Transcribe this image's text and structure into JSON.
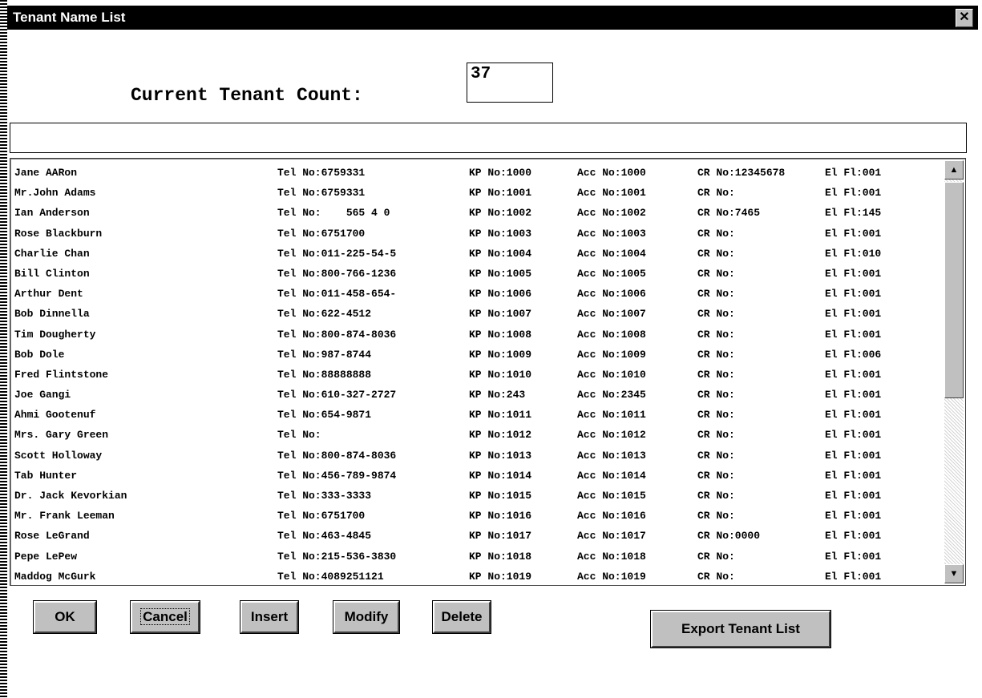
{
  "window": {
    "title": "Tenant Name List",
    "close_glyph": "✕"
  },
  "count": {
    "label": "Current Tenant Count:",
    "value": "37"
  },
  "search": {
    "value": ""
  },
  "tenants": [
    {
      "name": "Jane AARon",
      "tel": "Tel No:6759331",
      "kp": "KP No:1000",
      "acc": "Acc No:1000",
      "cr": "CR No:12345678",
      "el": "El Fl:001"
    },
    {
      "name": "Mr.John Adams",
      "tel": "Tel No:6759331",
      "kp": "KP No:1001",
      "acc": "Acc No:1001",
      "cr": "CR No:",
      "el": "El Fl:001"
    },
    {
      "name": "Ian Anderson",
      "tel": "Tel No:    565 4 0",
      "kp": "KP No:1002",
      "acc": "Acc No:1002",
      "cr": "CR No:7465",
      "el": "El Fl:145"
    },
    {
      "name": "Rose Blackburn",
      "tel": "Tel No:6751700",
      "kp": "KP No:1003",
      "acc": "Acc No:1003",
      "cr": "CR No:",
      "el": "El Fl:001"
    },
    {
      "name": "Charlie Chan",
      "tel": "Tel No:011-225-54-5",
      "kp": "KP No:1004",
      "acc": "Acc No:1004",
      "cr": "CR No:",
      "el": "El Fl:010"
    },
    {
      "name": "Bill Clinton",
      "tel": "Tel No:800-766-1236",
      "kp": "KP No:1005",
      "acc": "Acc No:1005",
      "cr": "CR No:",
      "el": "El Fl:001"
    },
    {
      "name": "Arthur Dent",
      "tel": "Tel No:011-458-654-",
      "kp": "KP No:1006",
      "acc": "Acc No:1006",
      "cr": "CR No:",
      "el": "El Fl:001"
    },
    {
      "name": "Bob Dinnella",
      "tel": "Tel No:622-4512",
      "kp": "KP No:1007",
      "acc": "Acc No:1007",
      "cr": "CR No:",
      "el": "El Fl:001"
    },
    {
      "name": "Tim Dougherty",
      "tel": "Tel No:800-874-8036",
      "kp": "KP No:1008",
      "acc": "Acc No:1008",
      "cr": "CR No:",
      "el": "El Fl:001"
    },
    {
      "name": "Bob Dole",
      "tel": "Tel No:987-8744",
      "kp": "KP No:1009",
      "acc": "Acc No:1009",
      "cr": "CR No:",
      "el": "El Fl:006"
    },
    {
      "name": "Fred Flintstone",
      "tel": "Tel No:88888888",
      "kp": "KP No:1010",
      "acc": "Acc No:1010",
      "cr": "CR No:",
      "el": "El Fl:001"
    },
    {
      "name": "Joe Gangi",
      "tel": "Tel No:610-327-2727",
      "kp": "KP No:243",
      "acc": "Acc No:2345",
      "cr": "CR No:",
      "el": "El Fl:001"
    },
    {
      "name": "Ahmi Gootenuf",
      "tel": "Tel No:654-9871",
      "kp": "KP No:1011",
      "acc": "Acc No:1011",
      "cr": "CR No:",
      "el": "El Fl:001"
    },
    {
      "name": "Mrs. Gary Green",
      "tel": "Tel No:",
      "kp": "KP No:1012",
      "acc": "Acc No:1012",
      "cr": "CR No:",
      "el": "El Fl:001"
    },
    {
      "name": "Scott Holloway",
      "tel": "Tel No:800-874-8036",
      "kp": "KP No:1013",
      "acc": "Acc No:1013",
      "cr": "CR No:",
      "el": "El Fl:001"
    },
    {
      "name": "Tab Hunter",
      "tel": "Tel No:456-789-9874",
      "kp": "KP No:1014",
      "acc": "Acc No:1014",
      "cr": "CR No:",
      "el": "El Fl:001"
    },
    {
      "name": "Dr. Jack Kevorkian",
      "tel": "Tel No:333-3333",
      "kp": "KP No:1015",
      "acc": "Acc No:1015",
      "cr": "CR No:",
      "el": "El Fl:001"
    },
    {
      "name": "Mr. Frank Leeman",
      "tel": "Tel No:6751700",
      "kp": "KP No:1016",
      "acc": "Acc No:1016",
      "cr": "CR No:",
      "el": "El Fl:001"
    },
    {
      "name": "Rose LeGrand",
      "tel": "Tel No:463-4845",
      "kp": "KP No:1017",
      "acc": "Acc No:1017",
      "cr": "CR No:0000",
      "el": "El Fl:001"
    },
    {
      "name": "Pepe LePew",
      "tel": "Tel No:215-536-3830",
      "kp": "KP No:1018",
      "acc": "Acc No:1018",
      "cr": "CR No:",
      "el": "El Fl:001"
    },
    {
      "name": "Maddog McGurk",
      "tel": "Tel No:4089251121",
      "kp": "KP No:1019",
      "acc": "Acc No:1019",
      "cr": "CR No:",
      "el": "El Fl:001"
    }
  ],
  "scrollbar": {
    "up_glyph": "▲",
    "down_glyph": "▼"
  },
  "buttons": {
    "ok": "OK",
    "cancel": "Cancel",
    "insert": "Insert",
    "modify": "Modify",
    "delete": "Delete",
    "export": "Export  Tenant List"
  }
}
